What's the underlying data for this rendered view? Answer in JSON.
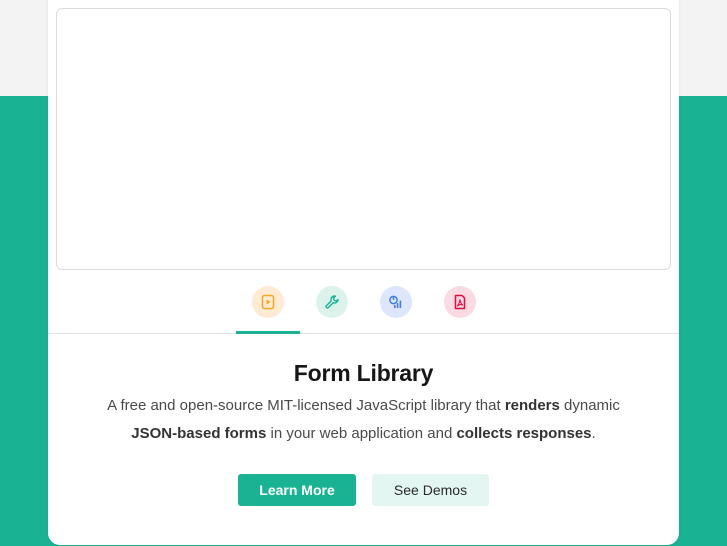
{
  "card": {
    "title": "Form Library",
    "description": {
      "part1": "A free and open-source MIT-licensed JavaScript library that ",
      "bold1": "renders",
      "part2": " dynamic ",
      "bold2": "JSON-based forms",
      "part3": " in your web application and ",
      "bold3": "collects responses",
      "part4": "."
    },
    "buttons": {
      "learn_more": "Learn More",
      "see_demos": "See Demos"
    }
  },
  "tabs": [
    {
      "icon": "play-document-icon",
      "color": "#f5a623",
      "selected": true
    },
    {
      "icon": "wrench-icon",
      "color": "#19b394",
      "selected": false
    },
    {
      "icon": "analytics-chart-icon",
      "color": "#437fd9",
      "selected": false
    },
    {
      "icon": "pdf-icon",
      "color": "#e50a3e",
      "selected": false
    }
  ],
  "colors": {
    "accent": "#19b394",
    "background": "#f3f3f3"
  }
}
